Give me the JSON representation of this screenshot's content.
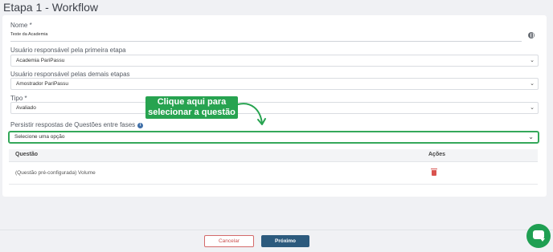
{
  "page": {
    "title": "Etapa 1 - Workflow"
  },
  "form": {
    "name_label": "Nome *",
    "name_value": "Teste da Academia",
    "first_user_label": "Usuário responsável pela primeira etapa",
    "first_user_value": "Academia PariPassu",
    "other_users_label": "Usuário responsável pelas demais etapas",
    "other_users_value": "Amostrador PariPassu",
    "type_label": "Tipo *",
    "type_value": "Avaliado",
    "persist_label": "Persistir respostas de Questões entre fases",
    "persist_placeholder": "Selecione uma opção"
  },
  "callout": {
    "line1": "Clique aqui para",
    "line2": "selecionar a questão"
  },
  "table": {
    "headers": [
      "Questão",
      "Ações"
    ],
    "rows": [
      {
        "question": "(Questão pré-configurada) Volume"
      }
    ]
  },
  "footer": {
    "cancel_label": "Cancelar",
    "next_label": "Próximo"
  },
  "colors": {
    "accent_green": "#27a350",
    "primary_blue": "#2c5a7d",
    "danger_red": "#d9534f"
  },
  "icons": [
    "globe-icon",
    "info-icon",
    "chevron-down-icon",
    "trash-icon",
    "chat-icon",
    "curved-arrow-icon"
  ]
}
